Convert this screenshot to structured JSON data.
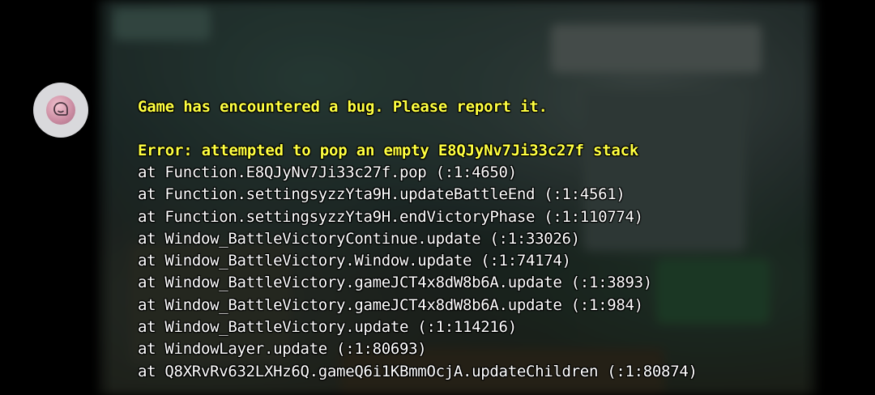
{
  "floating_button": {
    "icon": "assistant-bubble-icon"
  },
  "error": {
    "title": "Game has encountered a bug. Please report it.",
    "message": "Error: attempted to pop an empty E8QJyNv7Ji33c27f stack",
    "stack": [
      "at Function.E8QJyNv7Ji33c27f.pop (:1:4650)",
      "at Function.settingsyzzYta9H.updateBattleEnd (:1:4561)",
      "at Function.settingsyzzYta9H.endVictoryPhase (:1:110774)",
      "at Window_BattleVictoryContinue.update (:1:33026)",
      "at Window_BattleVictory.Window.update (:1:74174)",
      "at Window_BattleVictory.gameJCT4x8dW8b6A.update (:1:3893)",
      "at Window_BattleVictory.gameJCT4x8dW8b6A.update (:1:984)",
      "at Window_BattleVictory.update (:1:114216)",
      "at WindowLayer.update (:1:80693)",
      "at Q8XRvRv632LXHz6Q.gameQ6i1KBmmOcjA.updateChildren (:1:80874)"
    ]
  },
  "colors": {
    "title_text": "#ffff40",
    "stack_text": "#ffffff",
    "background": "#000000"
  }
}
